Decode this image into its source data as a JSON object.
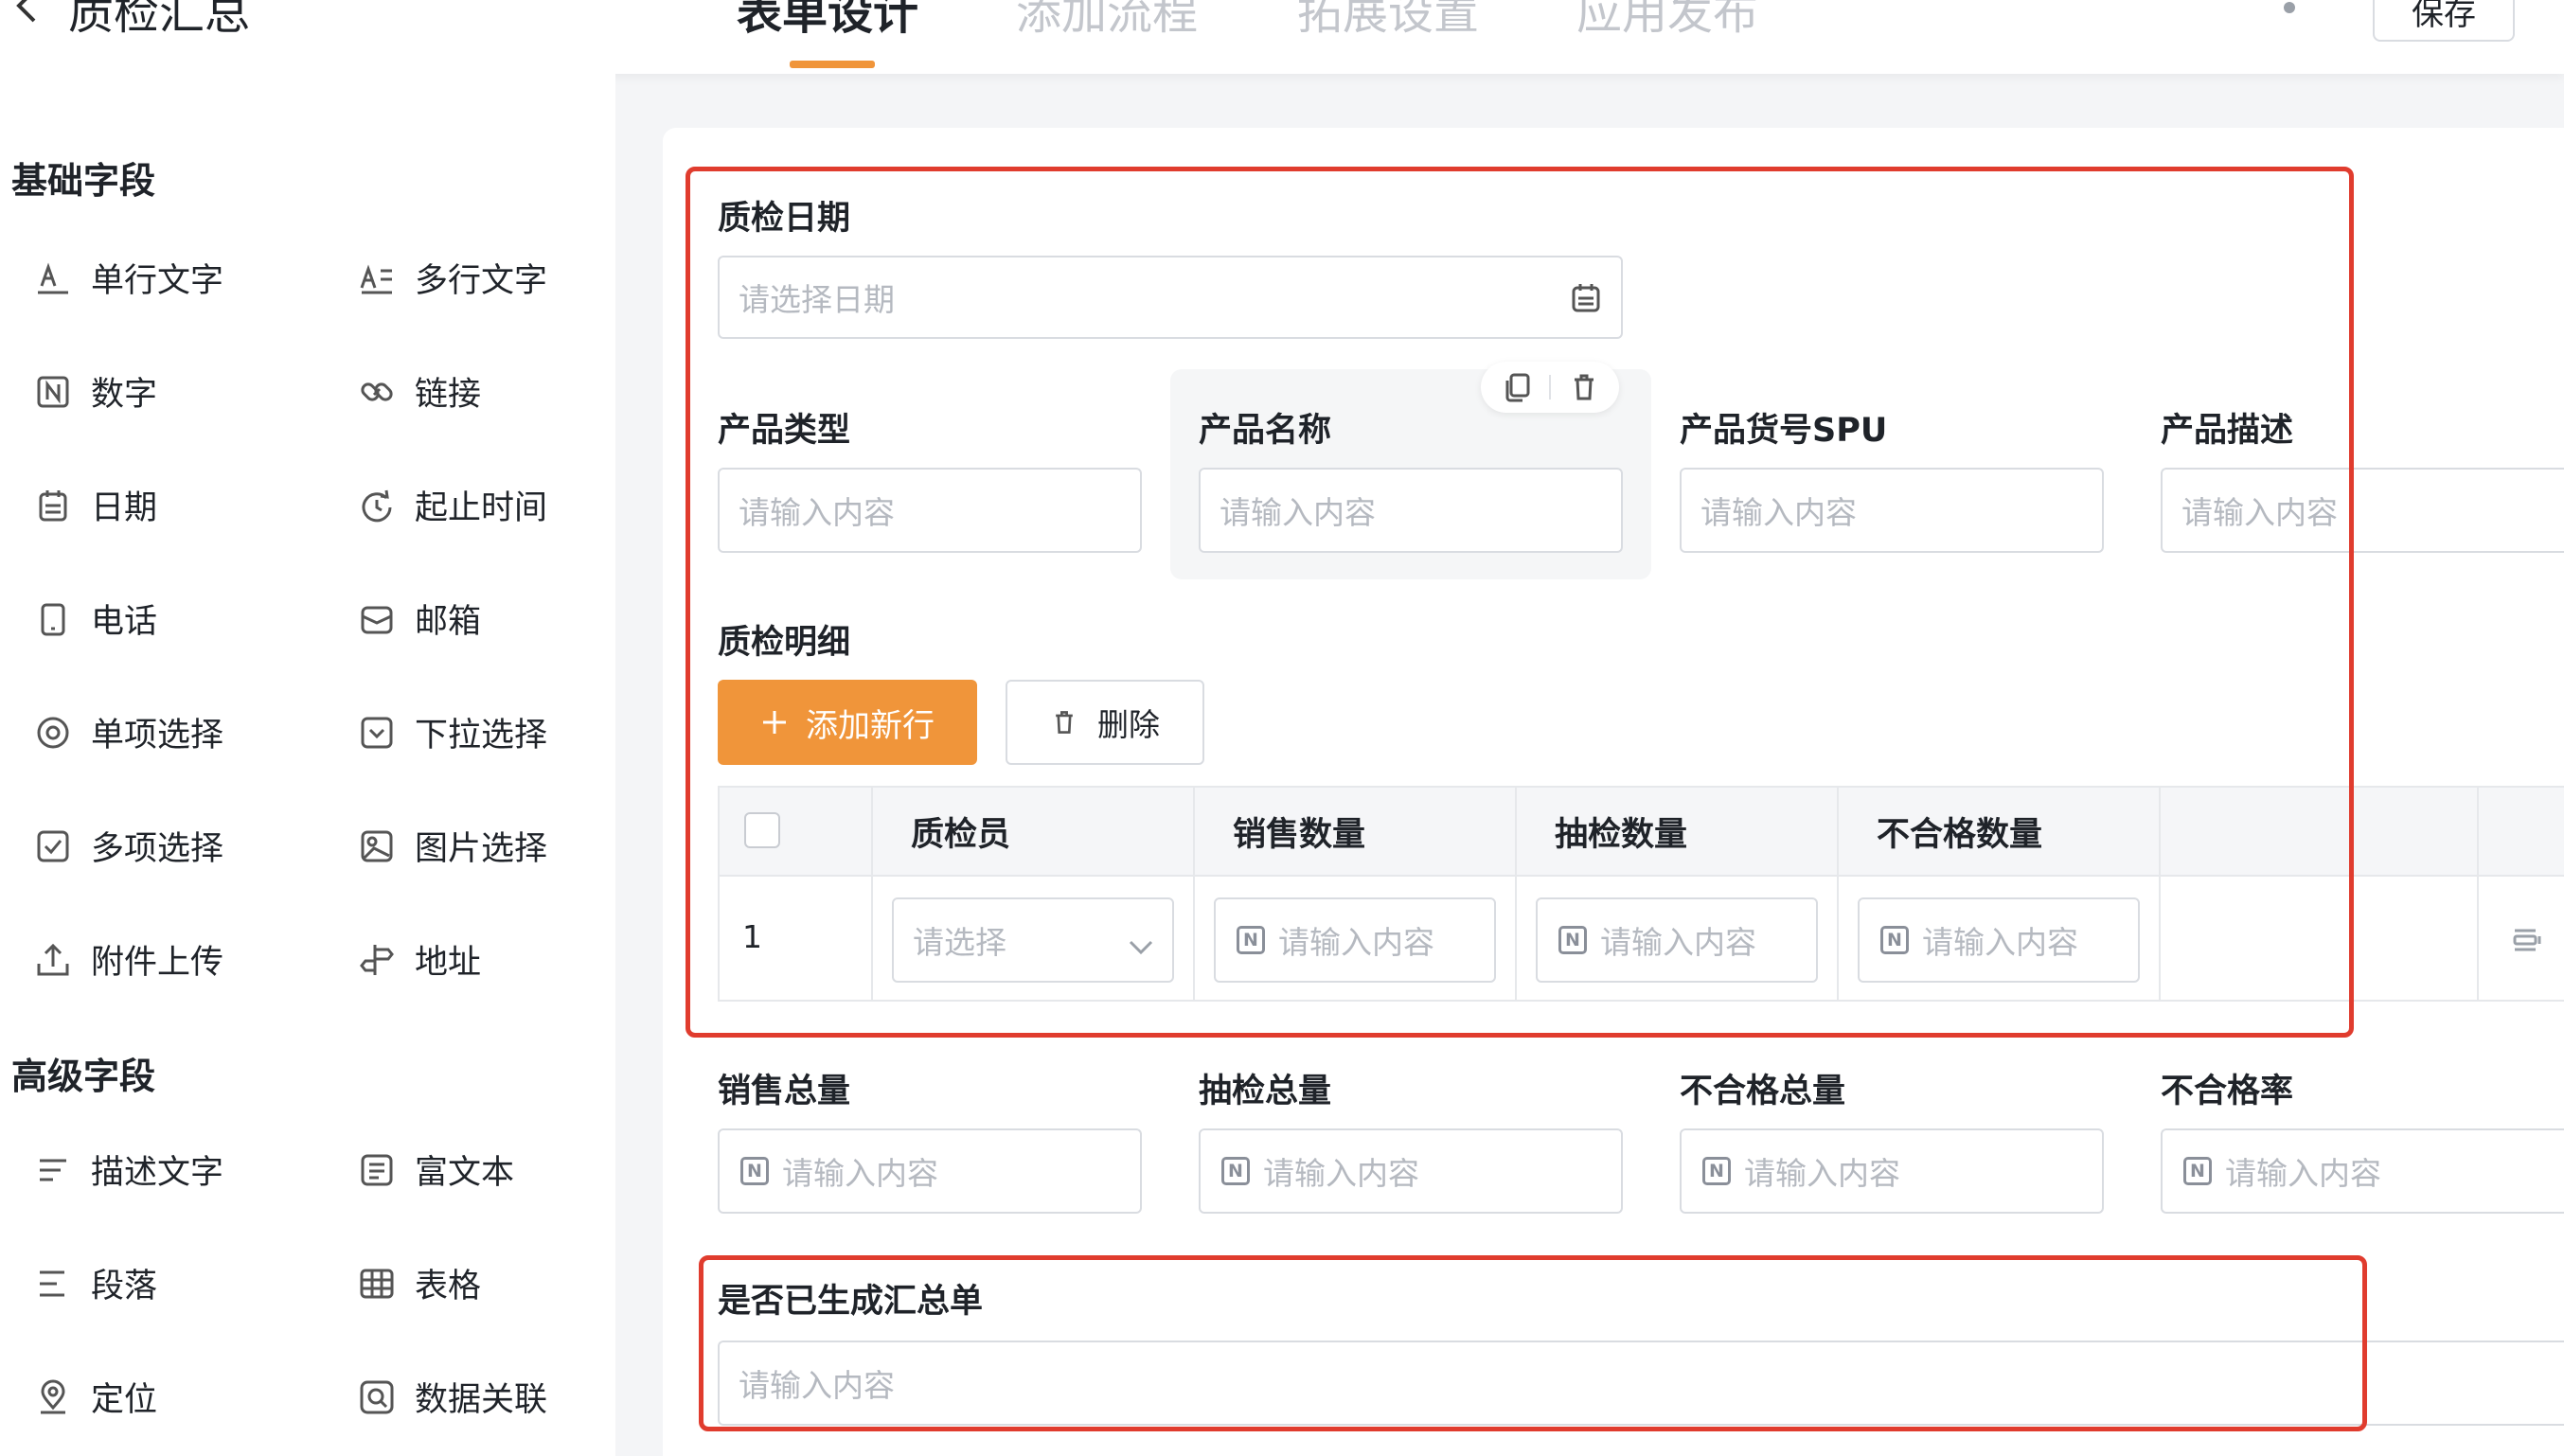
{
  "header": {
    "back_icon": "chevron-left-icon",
    "app_title": "质检汇总",
    "tabs": [
      {
        "label": "表单设计",
        "active": true
      },
      {
        "label": "添加流程",
        "active": false
      },
      {
        "label": "拓展设置",
        "active": false
      },
      {
        "label": "应用发布",
        "active": false
      }
    ],
    "save_label": "保存",
    "accent": "#f0953a"
  },
  "sidebar": {
    "basic_title": "基础字段",
    "basic_items": [
      {
        "label": "单行文字",
        "icon": "single-line-text-icon"
      },
      {
        "label": "多行文字",
        "icon": "multi-line-text-icon"
      },
      {
        "label": "数字",
        "icon": "number-icon"
      },
      {
        "label": "链接",
        "icon": "link-icon"
      },
      {
        "label": "日期",
        "icon": "calendar-icon"
      },
      {
        "label": "起止时间",
        "icon": "time-range-icon"
      },
      {
        "label": "电话",
        "icon": "phone-icon"
      },
      {
        "label": "邮箱",
        "icon": "mail-icon"
      },
      {
        "label": "单项选择",
        "icon": "radio-icon"
      },
      {
        "label": "下拉选择",
        "icon": "dropdown-icon"
      },
      {
        "label": "多项选择",
        "icon": "checkbox-icon"
      },
      {
        "label": "图片选择",
        "icon": "image-icon"
      },
      {
        "label": "附件上传",
        "icon": "upload-icon"
      },
      {
        "label": "地址",
        "icon": "signpost-icon"
      }
    ],
    "advanced_title": "高级字段",
    "advanced_items": [
      {
        "label": "描述文字",
        "icon": "description-icon"
      },
      {
        "label": "富文本",
        "icon": "rich-text-icon"
      },
      {
        "label": "段落",
        "icon": "paragraph-icon"
      },
      {
        "label": "表格",
        "icon": "table-icon"
      },
      {
        "label": "定位",
        "icon": "location-icon"
      },
      {
        "label": "数据关联",
        "icon": "data-link-icon"
      }
    ]
  },
  "form": {
    "date_label": "质检日期",
    "date_placeholder": "请选择日期",
    "product_fields": [
      {
        "label": "产品类型",
        "placeholder": "请输入内容"
      },
      {
        "label": "产品名称",
        "placeholder": "请输入内容"
      },
      {
        "label": "产品货号SPU",
        "placeholder": "请输入内容"
      },
      {
        "label": "产品描述",
        "placeholder": "请输入内容"
      }
    ],
    "detail_label": "质检明细",
    "add_row_label": "添加新行",
    "delete_label": "删除",
    "table": {
      "columns": [
        "质检员",
        "销售数量",
        "抽检数量",
        "不合格数量"
      ],
      "rows": [
        {
          "index": "1",
          "inspector_placeholder": "请选择",
          "cells": [
            "请输入内容",
            "请输入内容",
            "请输入内容"
          ]
        }
      ]
    },
    "summary_fields": [
      {
        "label": "销售总量",
        "placeholder": "请输入内容"
      },
      {
        "label": "抽检总量",
        "placeholder": "请输入内容"
      },
      {
        "label": "不合格总量",
        "placeholder": "请输入内容"
      },
      {
        "label": "不合格率",
        "placeholder": "请输入内容"
      }
    ],
    "generated_label": "是否已生成汇总单",
    "generated_placeholder": "请输入内容"
  }
}
